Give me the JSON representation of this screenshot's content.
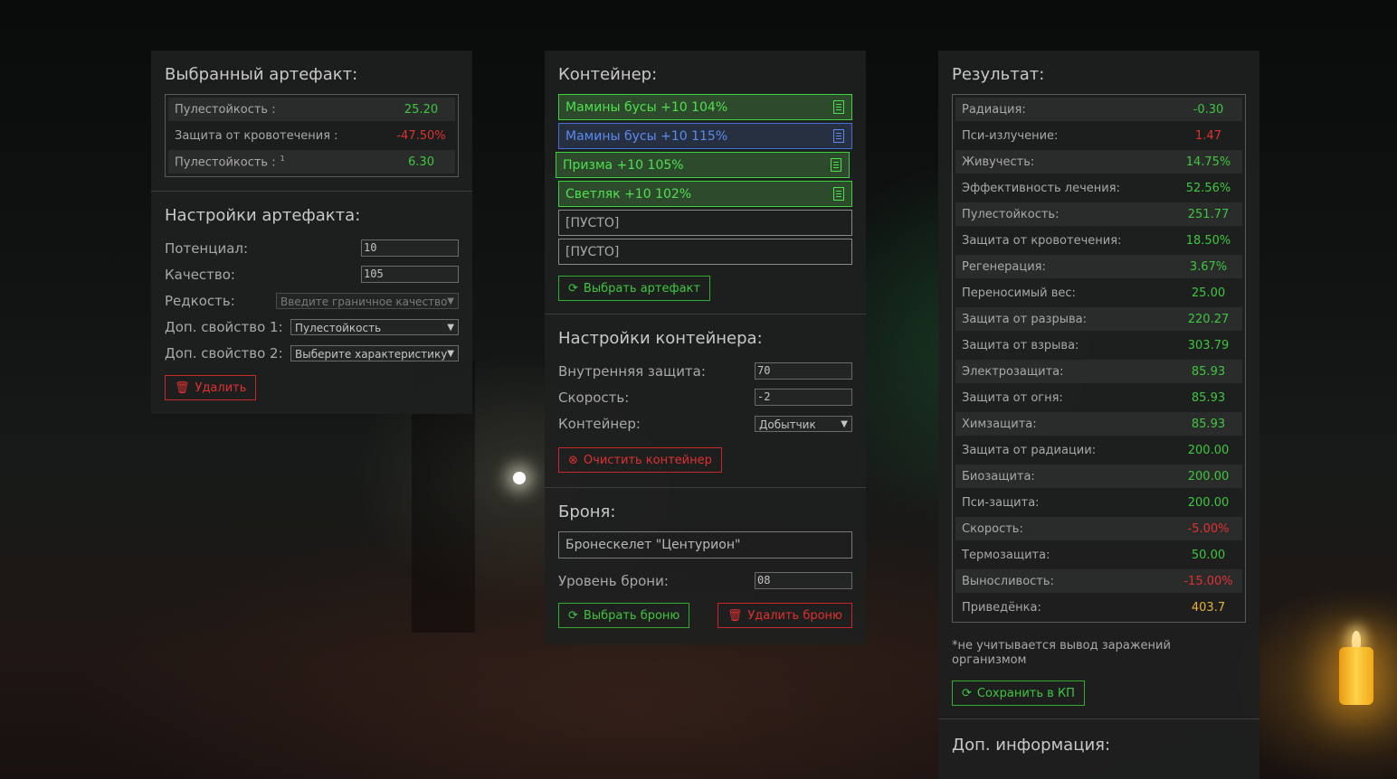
{
  "artifact_panel": {
    "title": "Выбранный артефакт:",
    "stats": [
      {
        "label": "Пулестойкость :",
        "value": "25.20",
        "color": "#3fc63f"
      },
      {
        "label": "Защита от кровотечения :",
        "value": "-47.50%",
        "color": "#e03131"
      },
      {
        "label": "Пулестойкость :",
        "sup": "1",
        "value": "6.30",
        "color": "#3fc63f"
      }
    ],
    "settings_title": "Настройки артефакта:",
    "potential_label": "Потенциал:",
    "potential_value": "10",
    "quality_label": "Качество:",
    "quality_value": "105",
    "rarity_label": "Редкость:",
    "rarity_value": "Введите граничное качество",
    "extra1_label": "Доп. свойство 1:",
    "extra1_value": "Пулестойкость",
    "extra2_label": "Доп. свойство 2:",
    "extra2_value": "Выберите характеристику",
    "delete_label": "Удалить"
  },
  "container_panel": {
    "title": "Контейнер:",
    "slots": [
      {
        "label": "Мамины бусы +10 104%",
        "style": "green"
      },
      {
        "label": "Мамины бусы +10 115%",
        "style": "blue"
      },
      {
        "label": "Призма +10 105%",
        "style": "green"
      },
      {
        "label": "Светляк +10 102%",
        "style": "green"
      },
      {
        "label": "[ПУСТО]",
        "style": "empty"
      },
      {
        "label": "[ПУСТО]",
        "style": "empty"
      }
    ],
    "select_artifact_label": "Выбрать артефакт",
    "settings_title": "Настройки контейнера:",
    "inner_protection_label": "Внутренняя защита:",
    "inner_protection_value": "70",
    "speed_label": "Скорость:",
    "speed_value": "-2",
    "container_label": "Контейнер:",
    "container_value": "Добытчик",
    "clear_label": "Очистить контейнер",
    "armor_title": "Броня:",
    "armor_name": "Бронескелет \"Центурион\"",
    "armor_level_label": "Уровень брони:",
    "armor_level_value": "08",
    "select_armor_label": "Выбрать броню",
    "delete_armor_label": "Удалить броню"
  },
  "result_panel": {
    "title": "Результат:",
    "stats": [
      {
        "label": "Радиация:",
        "value": "-0.30",
        "color": "#3fc63f"
      },
      {
        "label": "Пси-излучение:",
        "value": "1.47",
        "color": "#e03131"
      },
      {
        "label": "Живучесть:",
        "value": "14.75%",
        "color": "#3fc63f"
      },
      {
        "label": "Эффективность лечения:",
        "value": "52.56%",
        "color": "#3fc63f"
      },
      {
        "label": "Пулестойкость:",
        "value": "251.77",
        "color": "#3fc63f"
      },
      {
        "label": "Защита от кровотечения:",
        "value": "18.50%",
        "color": "#3fc63f"
      },
      {
        "label": "Регенерация:",
        "value": "3.67%",
        "color": "#3fc63f"
      },
      {
        "label": "Переносимый вес:",
        "value": "25.00",
        "color": "#3fc63f"
      },
      {
        "label": "Защита от разрыва:",
        "value": "220.27",
        "color": "#3fc63f"
      },
      {
        "label": "Защита от взрыва:",
        "value": "303.79",
        "color": "#3fc63f"
      },
      {
        "label": "Электрозащита:",
        "value": "85.93",
        "color": "#3fc63f"
      },
      {
        "label": "Защита от огня:",
        "value": "85.93",
        "color": "#3fc63f"
      },
      {
        "label": "Химзащита:",
        "value": "85.93",
        "color": "#3fc63f"
      },
      {
        "label": "Защита от радиации:",
        "value": "200.00",
        "color": "#3fc63f"
      },
      {
        "label": "Биозащита:",
        "value": "200.00",
        "color": "#3fc63f"
      },
      {
        "label": "Пси-защита:",
        "value": "200.00",
        "color": "#3fc63f"
      },
      {
        "label": "Скорость:",
        "value": "-5.00%",
        "color": "#e03131"
      },
      {
        "label": "Термозащита:",
        "value": "50.00",
        "color": "#3fc63f"
      },
      {
        "label": "Выносливость:",
        "value": "-15.00%",
        "color": "#e03131"
      },
      {
        "label": "Приведёнка:",
        "value": "403.7",
        "color": "#e8b23a"
      }
    ],
    "note": "*не учитывается вывод заражений организмом",
    "save_label": "Сохранить в КП",
    "extra_info_title": "Доп. информация:"
  }
}
